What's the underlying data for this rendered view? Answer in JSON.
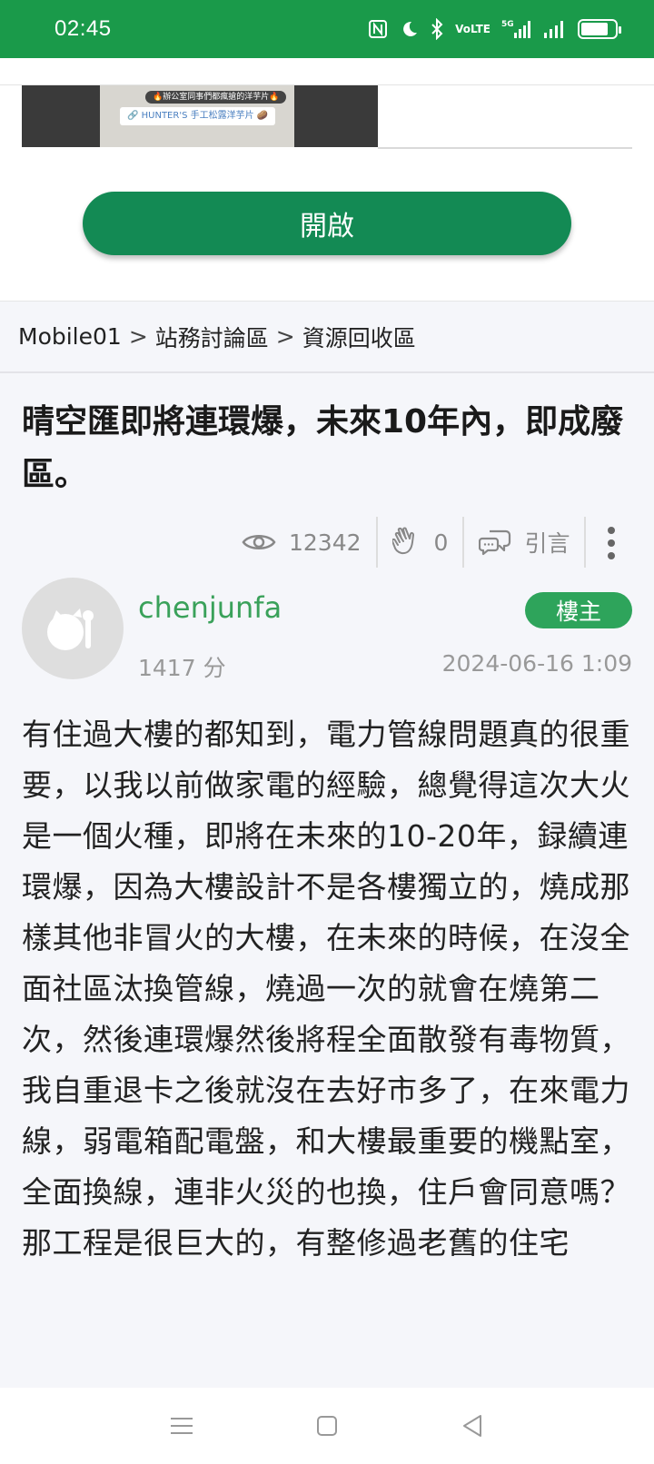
{
  "status_bar": {
    "time": "02:45",
    "network_label": "5G",
    "volte_label": "VoLTE",
    "battery_level": 0.8
  },
  "ad": {
    "image_caption_top": "🔥辦公室同事們都瘋搶的洋芋片🔥",
    "image_caption_main": "🔗 HUNTER'S 手工松露洋芋片 🥔",
    "open_button_label": "開啟"
  },
  "breadcrumb": {
    "items": [
      "Mobile01",
      "站務討論區",
      "資源回收區"
    ],
    "separator": ">"
  },
  "post": {
    "title": "晴空匯即將連環爆，未來10年內，即成廢區。",
    "views": "12342",
    "likes": "0",
    "quote_label": "引言",
    "author": "chenjunfa",
    "owner_badge": "樓主",
    "score": "1417 分",
    "date": "2024-06-16 1:09",
    "body": [
      "有住過大樓的都知到，電力管線問題真的很重要，以我以前做家電的經驗，總覺得這次大火是一個火種，即將在未來的10-20年，録續連環爆，因為大樓設計不是各樓獨立的，燒成那樣其他非冒火的大樓，在未來的時候，在沒全面社區汰換管線，燒過一次的就會在燒第二次，然後連環爆然後將程全面散發有毒物質，我自重退卡之後就沒在去好市多了，在來電力線，弱電箱配電盤，和大樓最重要的機點室，全面換線，連非火災的也換，住戶會同意嗎？",
      "那工程是很巨大的，有整修過老舊的住宅"
    ]
  },
  "colors": {
    "brand_green": "#1a9a4a",
    "button_green": "#138a54",
    "username_green": "#3aa15a"
  }
}
